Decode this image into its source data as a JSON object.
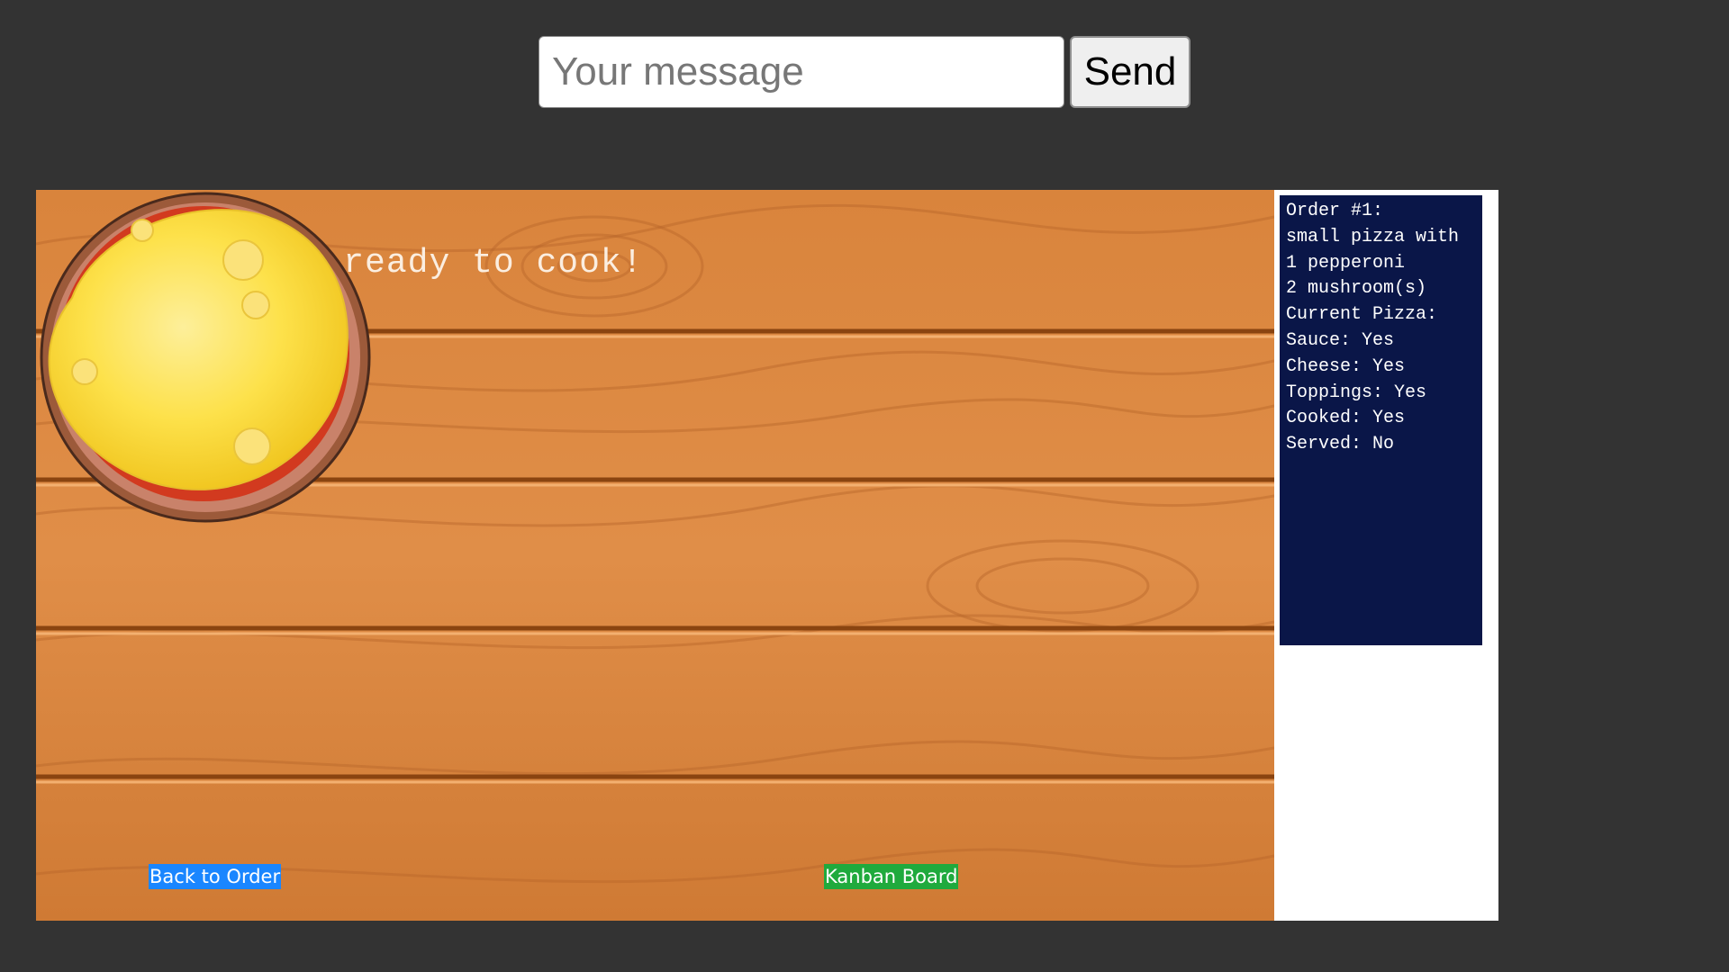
{
  "chat": {
    "input_placeholder": "Your message",
    "input_value": "",
    "send_label": "Send"
  },
  "game": {
    "status_message": "Pizza is ready to cook!",
    "nav": {
      "back_label": "Back to Order",
      "kanban_label": "Kanban Board"
    },
    "colors": {
      "background": "#333333",
      "wood": "#d47f3a",
      "panel": "#0a1648",
      "back_link": "#1a86ff",
      "kanban_link": "#1faa3d"
    },
    "order_panel": {
      "lines": [
        "Order #1:",
        "small pizza with",
        "1 pepperoni",
        "2 mushroom(s)",
        "Current Pizza:",
        "Sauce: Yes",
        "Cheese: Yes",
        "Toppings: Yes",
        "Cooked: Yes",
        "Served: No"
      ]
    },
    "pizza": {
      "sauce": "yes",
      "cheese": "yes"
    }
  }
}
